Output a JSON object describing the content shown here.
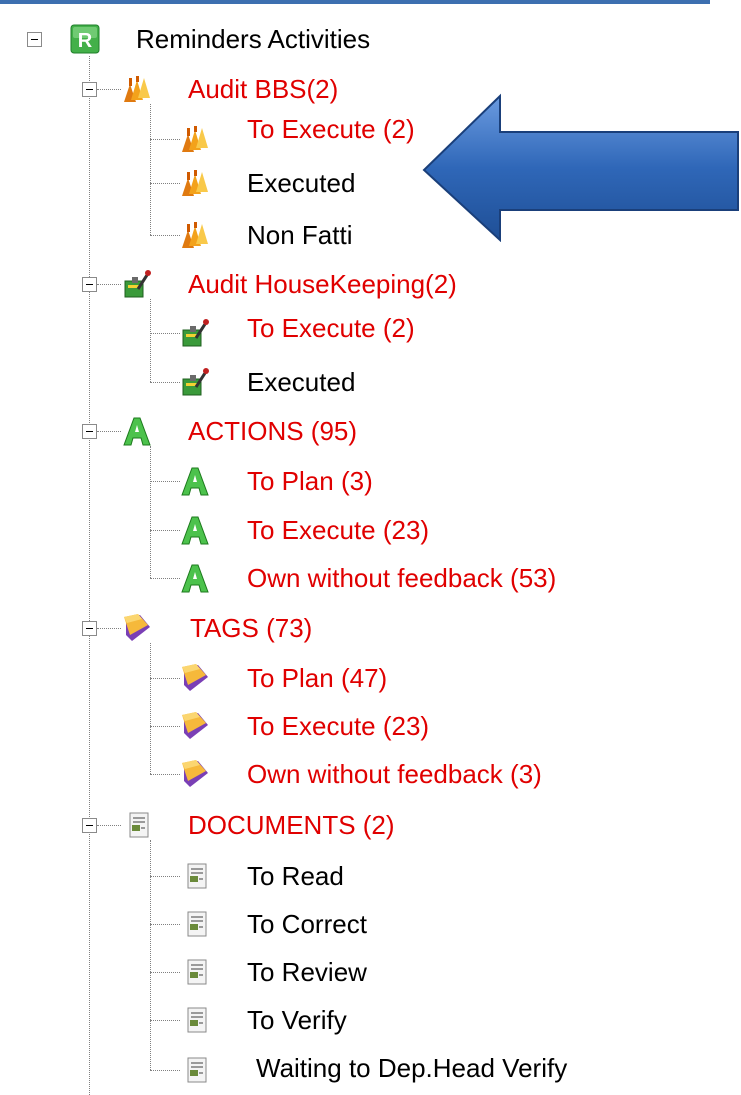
{
  "colors": {
    "accent_bar": "#3d6fb0",
    "red_text": "#e00000",
    "black_text": "#000000",
    "arrow": "#2f67b8"
  },
  "tree": {
    "root": {
      "label": "Reminders Activities",
      "icon": "reminders-r-icon"
    },
    "groups": [
      {
        "label": "Audit BBS(2)",
        "icon": "audit-bbs-icon",
        "children": [
          {
            "label": "To Execute (2)",
            "red": true
          },
          {
            "label": "Executed",
            "red": false
          },
          {
            "label": "Non Fatti",
            "red": false
          }
        ]
      },
      {
        "label": "Audit HouseKeeping(2)",
        "icon": "housekeeping-icon",
        "children": [
          {
            "label": "To Execute (2)",
            "red": true
          },
          {
            "label": "Executed",
            "red": false
          }
        ]
      },
      {
        "label": "ACTIONS (95)",
        "icon": "actions-a-icon",
        "children": [
          {
            "label": "To Plan (3)",
            "red": true
          },
          {
            "label": "To Execute (23)",
            "red": true
          },
          {
            "label": "Own without feedback (53)",
            "red": true
          }
        ]
      },
      {
        "label": "TAGS (73)",
        "icon": "tag-icon",
        "children": [
          {
            "label": "To Plan (47)",
            "red": true
          },
          {
            "label": "To Execute (23)",
            "red": true
          },
          {
            "label": "Own without feedback (3)",
            "red": true
          }
        ]
      },
      {
        "label": "DOCUMENTS (2)",
        "icon": "document-icon",
        "children": [
          {
            "label": "To Read",
            "red": false
          },
          {
            "label": "To Correct",
            "red": false
          },
          {
            "label": "To Review",
            "red": false
          },
          {
            "label": "To Verify",
            "red": false
          },
          {
            "label": "Waiting to Dep.Head Verify",
            "red": false
          }
        ]
      }
    ]
  }
}
